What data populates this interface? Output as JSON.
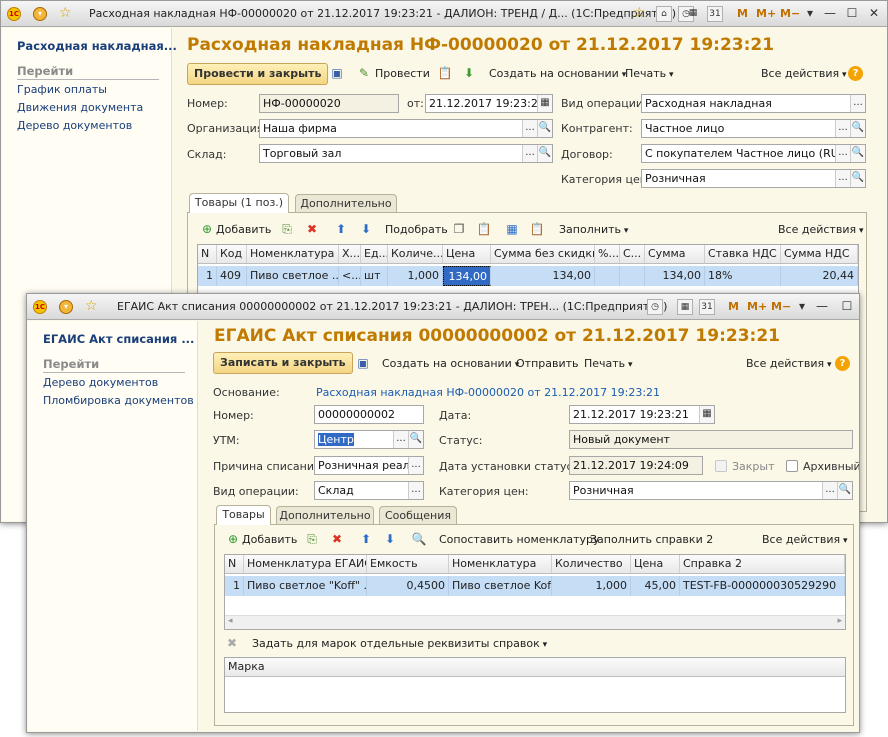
{
  "back": {
    "title": "Расходная накладная НФ-00000020 от 21.12.2017 19:23:21 - ДАЛИОН: ТРЕНД / Д... (1С:Предприятие)",
    "side_title": "Расходная накладная...",
    "side_heading": "Перейти",
    "side_links": [
      "График оплаты",
      "Движения документа",
      "Дерево документов"
    ],
    "heading": "Расходная накладная НФ-00000020 от 21.12.2017 19:23:21",
    "toolbar": {
      "post_close": "Провести и закрыть",
      "post": "Провести",
      "create_based": "Создать на основании",
      "print": "Печать",
      "all_actions": "Все действия",
      "help": "?"
    },
    "fields": {
      "number_label": "Номер:",
      "number": "НФ-00000020",
      "from_label": "от:",
      "date": "21.12.2017 19:23:21",
      "org_label": "Организация:",
      "org": "Наша фирма",
      "warehouse_label": "Склад:",
      "warehouse": "Торговый зал",
      "op_label": "Вид операции:",
      "op": "Расходная накладная",
      "contractor_label": "Контрагент:",
      "contractor": "Частное лицо",
      "contract_label": "Договор:",
      "contract": "С покупателем Частное лицо (RUB)",
      "price_cat_label": "Категория цен:",
      "price_cat": "Розничная"
    },
    "tabs": [
      "Товары (1 поз.)",
      "Дополнительно"
    ],
    "grid_toolbar": {
      "add": "Добавить",
      "pick": "Подобрать",
      "fill": "Заполнить",
      "all_actions": "Все действия"
    },
    "columns": [
      "N",
      "Код",
      "Номенклатура",
      "Х...",
      "Ед...",
      "Количе...",
      "Цена",
      "Сумма без скидки",
      "%...",
      "С...",
      "Сумма",
      "Ставка НДС",
      "Сумма НДС"
    ],
    "row": [
      "1",
      "409",
      "Пиво светлое ...",
      "<...",
      "шт",
      "1,000",
      "134,00",
      "134,00",
      "",
      "",
      "134,00",
      "18%",
      "20,44"
    ]
  },
  "front": {
    "title": "ЕГАИС Акт списания 00000000002 от 21.12.2017 19:23:21 - ДАЛИОН: ТРЕН... (1С:Предприятие)",
    "side_title": "ЕГАИС Акт списания ...",
    "side_heading": "Перейти",
    "side_links": [
      "Дерево документов",
      "Пломбировка документов"
    ],
    "heading": "ЕГАИС Акт списания 00000000002 от 21.12.2017 19:23:21",
    "toolbar": {
      "save_close": "Записать и закрыть",
      "create_based": "Создать на основании",
      "send": "Отправить",
      "print": "Печать",
      "all_actions": "Все действия",
      "help": "?"
    },
    "fields": {
      "basis_label": "Основание:",
      "basis": "Расходная накладная НФ-00000020 от 21.12.2017 19:23:21",
      "number_label": "Номер:",
      "number": "00000000002",
      "date_label": "Дата:",
      "date": "21.12.2017 19:23:21",
      "utm_label": "УТМ:",
      "utm": "Центр",
      "status_label": "Статус:",
      "status": "Новый документ",
      "reason_label": "Причина списания:",
      "reason": "Розничная реали:",
      "status_date_label": "Дата установки статуса:",
      "status_date": "21.12.2017 19:24:09",
      "closed_label": "Закрыт",
      "archive_label": "Архивный",
      "op_label": "Вид операции:",
      "op": "Склад",
      "price_cat_label": "Категория цен:",
      "price_cat": "Розничная"
    },
    "tabs": [
      "Товары",
      "Дополнительно",
      "Сообщения"
    ],
    "grid_toolbar": {
      "add": "Добавить",
      "match": "Сопоставить номенклатуру",
      "fill": "Заполнить справки 2",
      "all_actions": "Все действия"
    },
    "columns": [
      "N",
      "Номенклатура ЕГАИС",
      "Емкость",
      "Номенклатура",
      "Количество",
      "Цена",
      "Справка 2"
    ],
    "row": [
      "1",
      "Пиво светлое \"Koff\" ...",
      "0,4500",
      "Пиво светлое Koff",
      "1,000",
      "45,00",
      "TEST-FB-000000030529290"
    ],
    "marks_toolbar": "Задать для марок отдельные реквизиты справок",
    "marks_column": "Марка"
  },
  "common": {
    "m": "M",
    "mplus": "M+",
    "mminus": "M−"
  }
}
